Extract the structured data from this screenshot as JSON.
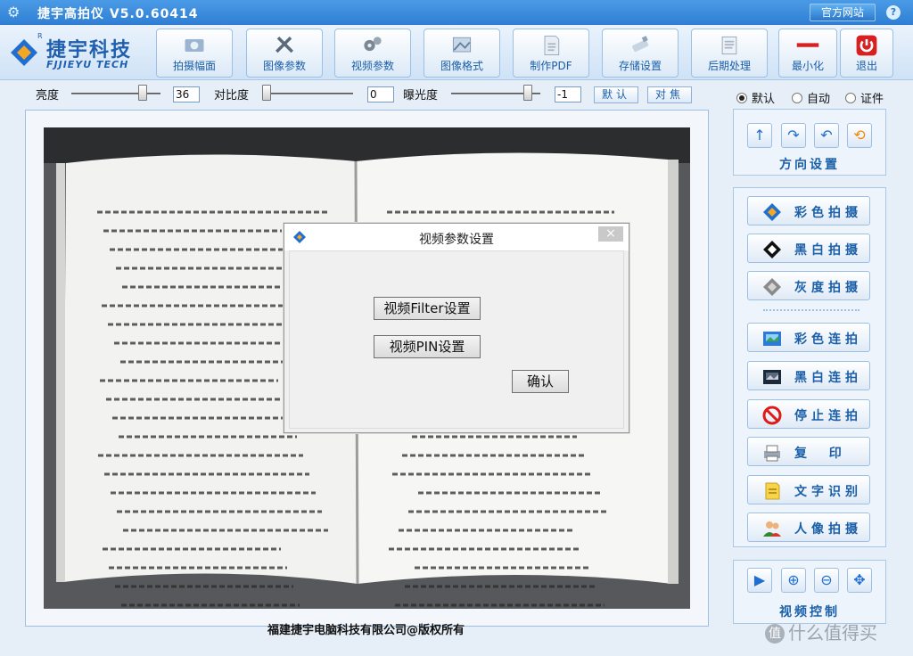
{
  "app": {
    "title": "捷宇高拍仪 V5.0.60414",
    "site_button": "官方网站",
    "help": "?"
  },
  "logo": {
    "name": "捷宇科技",
    "sub": "FJJIEYU TECH",
    "reg": "R"
  },
  "toolbar": [
    {
      "label": "拍摄幅面",
      "icon": "camera-icon"
    },
    {
      "label": "图像参数",
      "icon": "tools-icon"
    },
    {
      "label": "视频参数",
      "icon": "gears-icon"
    },
    {
      "label": "图像格式",
      "icon": "image-format-icon"
    },
    {
      "label": "制作PDF",
      "icon": "pdf-icon"
    },
    {
      "label": "存储设置",
      "icon": "usb-drive-icon"
    },
    {
      "label": "后期处理",
      "icon": "notepad-icon"
    },
    {
      "label": "最小化",
      "icon": "minimize-icon"
    },
    {
      "label": "退出",
      "icon": "power-icon"
    }
  ],
  "controls": {
    "brightness": {
      "label": "亮度",
      "value": "36"
    },
    "contrast": {
      "label": "对比度",
      "value": "0"
    },
    "exposure": {
      "label": "曝光度",
      "value": "-1"
    },
    "default_btn": "默认",
    "focus_btn": "对焦"
  },
  "mode_radios": {
    "selected": "默认",
    "options": [
      "默认",
      "自动",
      "证件"
    ]
  },
  "direction_panel": {
    "title": "方向设置"
  },
  "capture_buttons": [
    {
      "label": "彩色拍摄",
      "icon": "color-capture-icon"
    },
    {
      "label": "黑白拍摄",
      "icon": "bw-capture-icon"
    },
    {
      "label": "灰度拍摄",
      "icon": "gray-capture-icon"
    }
  ],
  "continuous_buttons": [
    {
      "label": "彩色连拍",
      "icon": "color-burst-icon"
    },
    {
      "label": "黑白连拍",
      "icon": "bw-burst-icon"
    },
    {
      "label": "停止连拍",
      "icon": "stop-icon"
    },
    {
      "label": "复  印",
      "icon": "printer-icon"
    },
    {
      "label": "文字识别",
      "icon": "ocr-icon"
    },
    {
      "label": "人像拍摄",
      "icon": "people-icon"
    }
  ],
  "video_panel": {
    "title": "视频控制"
  },
  "dialog": {
    "title": "视频参数设置",
    "close": "×",
    "filter_btn": "视频Filter设置",
    "pin_btn": "视频PIN设置",
    "ok_btn": "确认"
  },
  "footer": {
    "copyright": "福建捷宇电脑科技有限公司@版权所有"
  },
  "watermark": {
    "glyph": "值",
    "text": "什么值得买"
  }
}
